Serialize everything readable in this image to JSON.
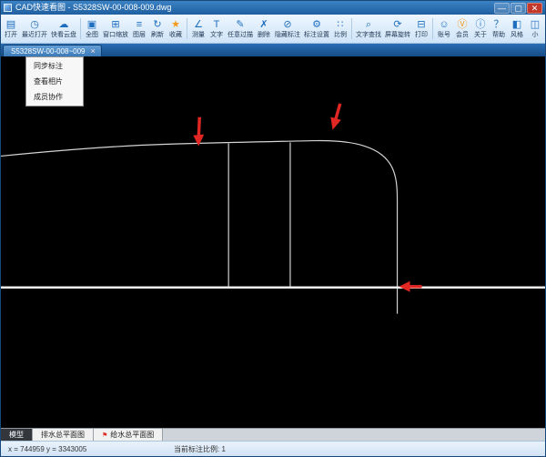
{
  "window": {
    "title": "CAD快速看图 - S5328SW-00-008-009.dwg",
    "controls": {
      "minimize": "—",
      "maximize": "▢",
      "close": "✕"
    }
  },
  "toolbar": {
    "items": [
      {
        "label": "打开",
        "glyph": "▤"
      },
      {
        "label": "最近打开",
        "glyph": "◷"
      },
      {
        "label": "快看云盘",
        "glyph": "☁"
      },
      {
        "label": "全图",
        "glyph": "▣"
      },
      {
        "label": "窗口缩放",
        "glyph": "⊞"
      },
      {
        "label": "图层",
        "glyph": "≡"
      },
      {
        "label": "刷新",
        "glyph": "↻"
      },
      {
        "label": "收藏",
        "glyph": "★"
      },
      {
        "label": "测量",
        "glyph": "∠"
      },
      {
        "label": "文字",
        "glyph": "T"
      },
      {
        "label": "任意过描",
        "glyph": "✎"
      },
      {
        "label": "删除",
        "glyph": "✗"
      },
      {
        "label": "隐藏标注",
        "glyph": "⊘"
      },
      {
        "label": "标注设置",
        "glyph": "⚙"
      },
      {
        "label": "比例",
        "glyph": "∷"
      },
      {
        "label": "文字查找",
        "glyph": "⌕"
      },
      {
        "label": "屏幕旋转",
        "glyph": "⟳"
      },
      {
        "label": "打印",
        "glyph": "⊟"
      },
      {
        "label": "账号",
        "glyph": "☺"
      },
      {
        "label": "会员",
        "glyph": "Ⓥ"
      },
      {
        "label": "关于",
        "glyph": "ⓘ"
      },
      {
        "label": "帮助",
        "glyph": "？"
      },
      {
        "label": "风格",
        "glyph": "◧"
      },
      {
        "label": "小",
        "glyph": "◫"
      }
    ]
  },
  "tabbar": {
    "tabs": [
      {
        "label": "S5328SW-00-008~009",
        "close": "×"
      }
    ]
  },
  "context_menu": {
    "items": [
      "同步标注",
      "查看相片",
      "成员协作"
    ]
  },
  "sheet_tabs": [
    {
      "label": "模型",
      "marker": ""
    },
    {
      "label": "排水总平面图",
      "marker": ""
    },
    {
      "label": "给水总平面图",
      "marker": "⚑"
    }
  ],
  "statusbar": {
    "coordinates": "x = 744959  y = 3343005",
    "scale": "当前标注比例: 1"
  },
  "colors": {
    "titlebar": "#2f74c0",
    "toolbar_bg": "#dceafb",
    "tabbar_bg": "#1b5898",
    "canvas_bg": "#000000",
    "cad_line": "#d4d4d4",
    "annotation_red": "#e02723",
    "accent_blue": "#1e6fc0"
  }
}
